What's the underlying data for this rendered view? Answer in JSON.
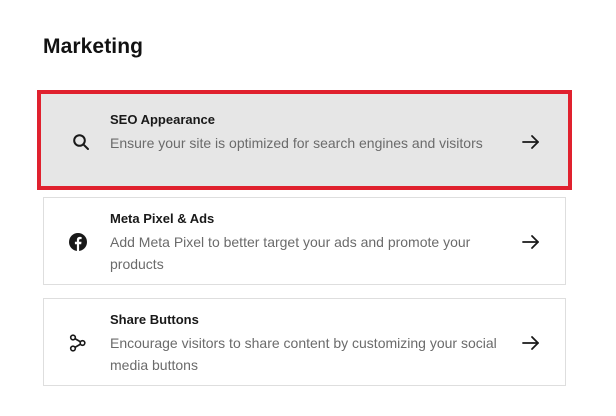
{
  "section": {
    "title": "Marketing"
  },
  "items": [
    {
      "title": "SEO Appearance",
      "description": "Ensure your site is optimized for search engines and visitors",
      "icon": "search-icon",
      "selected": true
    },
    {
      "title": "Meta Pixel & Ads",
      "description": "Add Meta Pixel to better target your ads and promote your products",
      "icon": "facebook-icon",
      "selected": false
    },
    {
      "title": "Share Buttons",
      "description": "Encourage visitors to share content by customizing your social media buttons",
      "icon": "share-icon",
      "selected": false
    }
  ],
  "colors": {
    "selection_border": "#e0212e",
    "selected_background": "#e6e6e6",
    "card_border": "#dedede",
    "text_primary": "#191919",
    "text_secondary": "#6b6b6b"
  }
}
